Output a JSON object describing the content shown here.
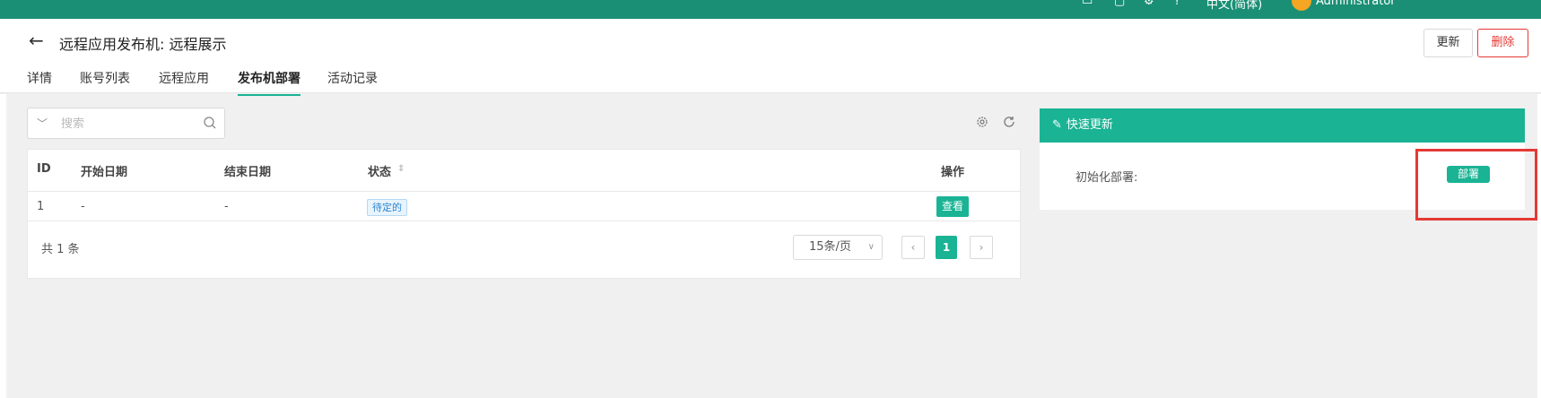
{
  "topbar": {
    "color": "#1a8f75",
    "items": [
      {
        "icon": "monitor-icon"
      },
      {
        "icon": "window-icon"
      },
      {
        "icon": "gear-icon"
      },
      {
        "icon": "help-icon"
      },
      {
        "label": "中文(简体)"
      },
      {
        "avatar": "avatar",
        "user": "Administrator"
      }
    ]
  },
  "header": {
    "back_icon": "arrow-left-icon",
    "title": "远程应用发布机: 远程展示",
    "update_label": "更新",
    "delete_label": "删除"
  },
  "tabs": [
    {
      "label": "详情",
      "active": false
    },
    {
      "label": "账号列表",
      "active": false
    },
    {
      "label": "远程应用",
      "active": false
    },
    {
      "label": "发布机部署",
      "active": true
    },
    {
      "label": "活动记录",
      "active": false
    }
  ],
  "toolbar": {
    "search_placeholder": "搜索",
    "settings_icon": "gear-icon",
    "refresh_icon": "refresh-icon"
  },
  "table": {
    "columns": [
      "ID",
      "开始日期",
      "结束日期",
      "状态",
      "操作"
    ],
    "rows": [
      {
        "id": "1",
        "start": "-",
        "end": "-",
        "status": "待定的",
        "action": "查看"
      }
    ],
    "total": "共 1 条",
    "page_size": "15条/页",
    "current_page": "1"
  },
  "quick_update": {
    "title": "快速更新",
    "label": "初始化部署:",
    "button": "部署"
  },
  "colors": {
    "accent": "#1ab394",
    "danger": "#e53935",
    "tag_blue": "#2b85d0"
  }
}
